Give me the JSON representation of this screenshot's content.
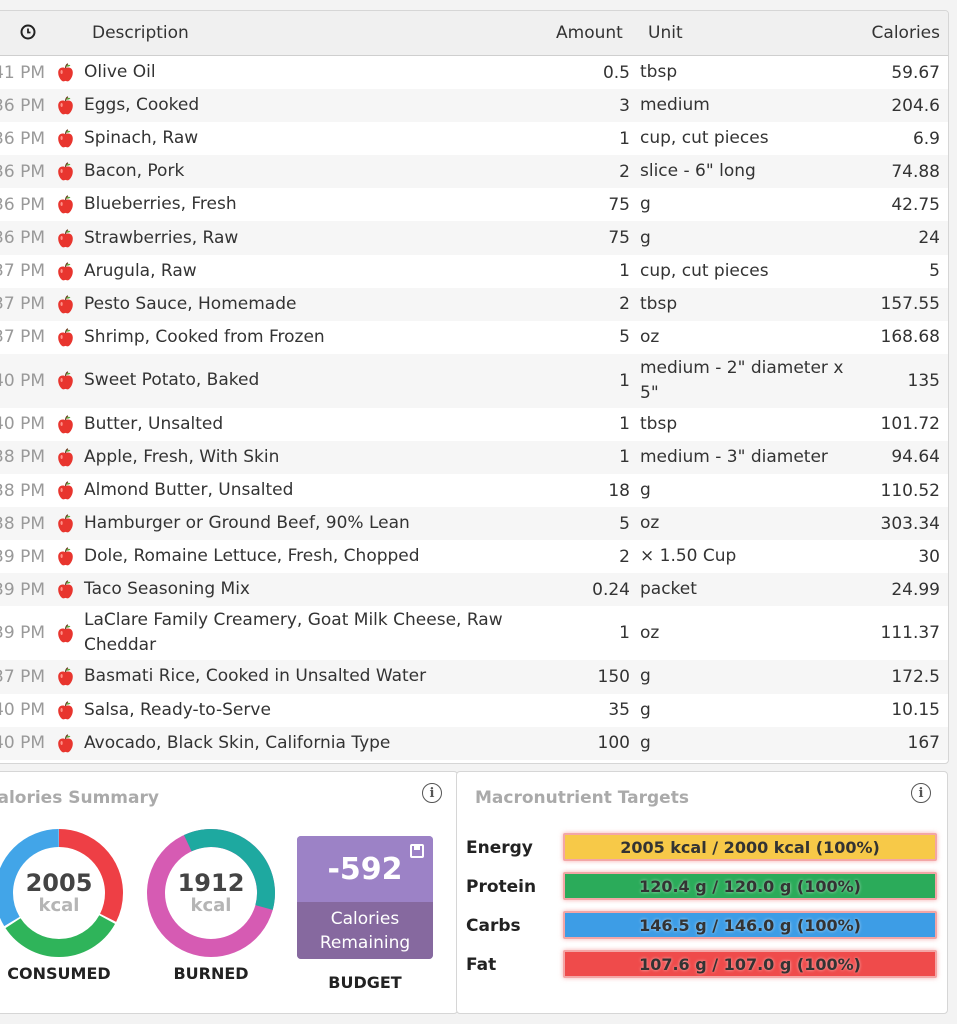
{
  "table": {
    "columns": {
      "description": "Description",
      "amount": "Amount",
      "unit": "Unit",
      "calories": "Calories"
    },
    "rows": [
      {
        "time": "41 PM",
        "description": "Olive Oil",
        "amount": "0.5",
        "unit": "tbsp",
        "calories": "59.67"
      },
      {
        "time": "36 PM",
        "description": "Eggs, Cooked",
        "amount": "3",
        "unit": "medium",
        "calories": "204.6"
      },
      {
        "time": "36 PM",
        "description": "Spinach, Raw",
        "amount": "1",
        "unit": "cup, cut pieces",
        "calories": "6.9"
      },
      {
        "time": "36 PM",
        "description": "Bacon, Pork",
        "amount": "2",
        "unit": "slice - 6\" long",
        "calories": "74.88"
      },
      {
        "time": "36 PM",
        "description": "Blueberries, Fresh",
        "amount": "75",
        "unit": "g",
        "calories": "42.75"
      },
      {
        "time": "36 PM",
        "description": "Strawberries, Raw",
        "amount": "75",
        "unit": "g",
        "calories": "24"
      },
      {
        "time": "37 PM",
        "description": "Arugula, Raw",
        "amount": "1",
        "unit": "cup, cut pieces",
        "calories": "5"
      },
      {
        "time": "37 PM",
        "description": "Pesto Sauce, Homemade",
        "amount": "2",
        "unit": "tbsp",
        "calories": "157.55"
      },
      {
        "time": "37 PM",
        "description": "Shrimp, Cooked from Frozen",
        "amount": "5",
        "unit": "oz",
        "calories": "168.68"
      },
      {
        "time": "40 PM",
        "description": "Sweet Potato, Baked",
        "amount": "1",
        "unit": "medium - 2\" diameter x 5\"",
        "calories": "135"
      },
      {
        "time": "40 PM",
        "description": "Butter, Unsalted",
        "amount": "1",
        "unit": "tbsp",
        "calories": "101.72"
      },
      {
        "time": "38 PM",
        "description": "Apple, Fresh, With Skin",
        "amount": "1",
        "unit": "medium - 3\" diameter",
        "calories": "94.64"
      },
      {
        "time": "38 PM",
        "description": "Almond Butter, Unsalted",
        "amount": "18",
        "unit": "g",
        "calories": "110.52"
      },
      {
        "time": "38 PM",
        "description": "Hamburger or Ground Beef, 90% Lean",
        "amount": "5",
        "unit": "oz",
        "calories": "303.34"
      },
      {
        "time": "39 PM",
        "description": "Dole, Romaine Lettuce, Fresh, Chopped",
        "amount": "2",
        "unit": "× 1.50 Cup",
        "calories": "30"
      },
      {
        "time": "39 PM",
        "description": "Taco Seasoning Mix",
        "amount": "0.24",
        "unit": "packet",
        "calories": "24.99"
      },
      {
        "time": "39 PM",
        "description": "LaClare Family Creamery, Goat Milk Cheese, Raw Cheddar",
        "amount": "1",
        "unit": "oz",
        "calories": "111.37"
      },
      {
        "time": "37 PM",
        "description": "Basmati Rice, Cooked in Unsalted Water",
        "amount": "150",
        "unit": "g",
        "calories": "172.5"
      },
      {
        "time": "40 PM",
        "description": "Salsa, Ready-to-Serve",
        "amount": "35",
        "unit": "g",
        "calories": "10.15"
      },
      {
        "time": "40 PM",
        "description": "Avocado, Black Skin, California Type",
        "amount": "100",
        "unit": "g",
        "calories": "167"
      }
    ]
  },
  "summary": {
    "title": "Calories Summary",
    "consumed": {
      "value": "2005",
      "unit": "kcal",
      "label": "CONSUMED"
    },
    "burned": {
      "value": "1912",
      "unit": "kcal",
      "label": "BURNED"
    },
    "budget": {
      "value": "-592",
      "line1": "Calories",
      "line2": "Remaining",
      "label": "BUDGET"
    }
  },
  "macros": {
    "title": "Macronutrient Targets",
    "items": [
      {
        "label": "Energy",
        "text": "2005 kcal / 2000 kcal (100%)",
        "color": "#f7c948"
      },
      {
        "label": "Protein",
        "text": "120.4 g / 120.0 g (100%)",
        "color": "#2bab5a"
      },
      {
        "label": "Carbs",
        "text": "146.5 g / 146.0 g (100%)",
        "color": "#3d9de6"
      },
      {
        "label": "Fat",
        "text": "107.6 g / 107.0 g (100%)",
        "color": "#ef4b4b"
      }
    ]
  },
  "colors": {
    "consumed_red": "#ee3f45",
    "consumed_blue": "#42a5e8",
    "consumed_green": "#2fb45a",
    "burned_teal": "#1ea9a0",
    "burned_pink": "#d65bb3",
    "budget_purple": "#9c82c6"
  },
  "icons": {
    "time": "clock-icon",
    "food": "apple-icon",
    "info": "info-icon",
    "save": "save-icon"
  }
}
